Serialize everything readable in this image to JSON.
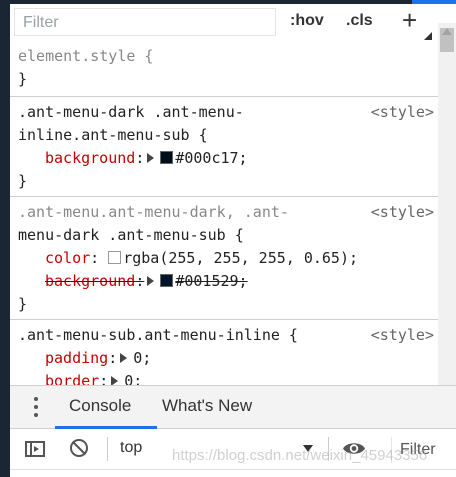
{
  "styles_pane": {
    "filter_placeholder": "Filter",
    "hov_label": ":hov",
    "cls_label": ".cls",
    "add_rule_label": "+"
  },
  "rules": {
    "r0": {
      "selector": "element.style {",
      "close": "}"
    },
    "r1": {
      "selector_line1": ".ant-menu-dark .ant-menu-",
      "selector_line2": "inline.ant-menu-sub {",
      "source": "<style>",
      "p1_name": "background",
      "p1_colon": ":",
      "p1_value": "#000c17;",
      "p1_swatch_color": "#000c17",
      "close": "}"
    },
    "r2": {
      "selector_line1": ".ant-menu.ant-menu-dark, .ant-",
      "selector_line2": "menu-dark .ant-menu-sub {",
      "source": "<style>",
      "p1_name": "color",
      "p1_colon": ":",
      "p1_value": "rgba(255, 255, 255, 0.65);",
      "p1_swatch_color": "rgba(255,255,255,0.65)",
      "p2_name": "background",
      "p2_colon": ":",
      "p2_value": "#001529;",
      "p2_swatch_color": "#001529",
      "close": "}"
    },
    "r3": {
      "selector_line1": ".ant-menu-sub.ant-menu-inline {",
      "source": "<style>",
      "p1_name": "padding",
      "p1_colon": ":",
      "p1_value": "0;",
      "p2_name": "border",
      "p2_colon": ":",
      "p2_value": "0;"
    }
  },
  "drawer": {
    "tab_console": "Console",
    "tab_whats_new": "What's New",
    "context_value": "top",
    "filter_placeholder": "Filter"
  },
  "watermark": "https://blog.csdn.net/weixin_45943356",
  "colors": {
    "accent": "#1a73e8",
    "prop_name": "#c80000",
    "chrome_dark": "#1b2635"
  }
}
